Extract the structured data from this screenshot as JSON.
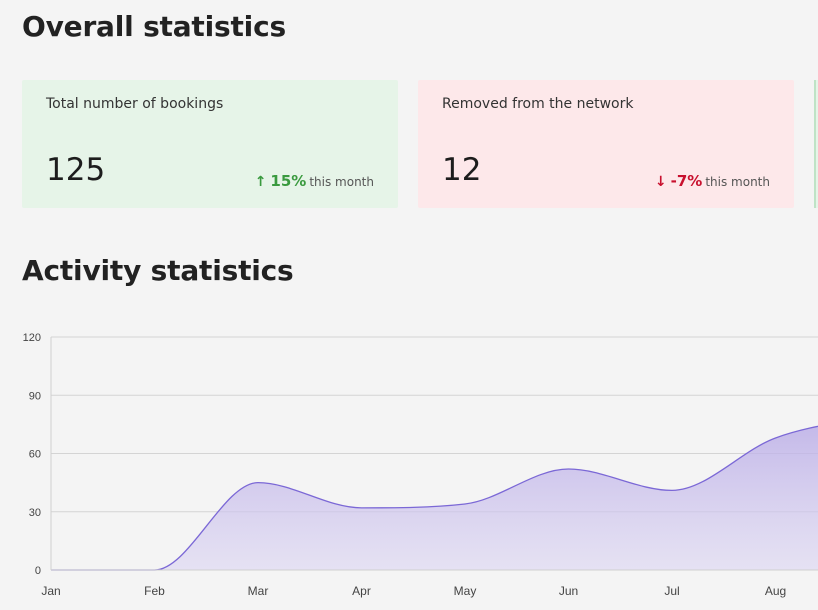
{
  "overall": {
    "title": "Overall statistics",
    "cards": [
      {
        "label": "Total number of bookings",
        "value": "125",
        "trend_arrow": "↑",
        "trend_value": "15%",
        "trend_suffix": "this month",
        "trend_direction": "up",
        "accent": "#3a9a3f",
        "background": "#e6f4e8"
      },
      {
        "label": "Removed from the network",
        "value": "12",
        "trend_arrow": "↓",
        "trend_value": "-7%",
        "trend_suffix": "this month",
        "trend_direction": "down",
        "accent": "#c8102e",
        "background": "#fde8ea"
      }
    ]
  },
  "activity": {
    "title": "Activity statistics"
  },
  "chart_data": {
    "type": "area",
    "title": "",
    "xlabel": "",
    "ylabel": "",
    "categories": [
      "Jan",
      "Feb",
      "Mar",
      "Apr",
      "May",
      "Jun",
      "Jul",
      "Aug"
    ],
    "x_extends_beyond": true,
    "series": [
      {
        "values": [
          0,
          0,
          45,
          32,
          34,
          52,
          41,
          68
        ],
        "continues_to": 80,
        "color": "#7b68d6"
      }
    ],
    "ylim": [
      0,
      120
    ],
    "yticks": [
      0,
      30,
      60,
      90,
      120
    ],
    "grid": true
  }
}
